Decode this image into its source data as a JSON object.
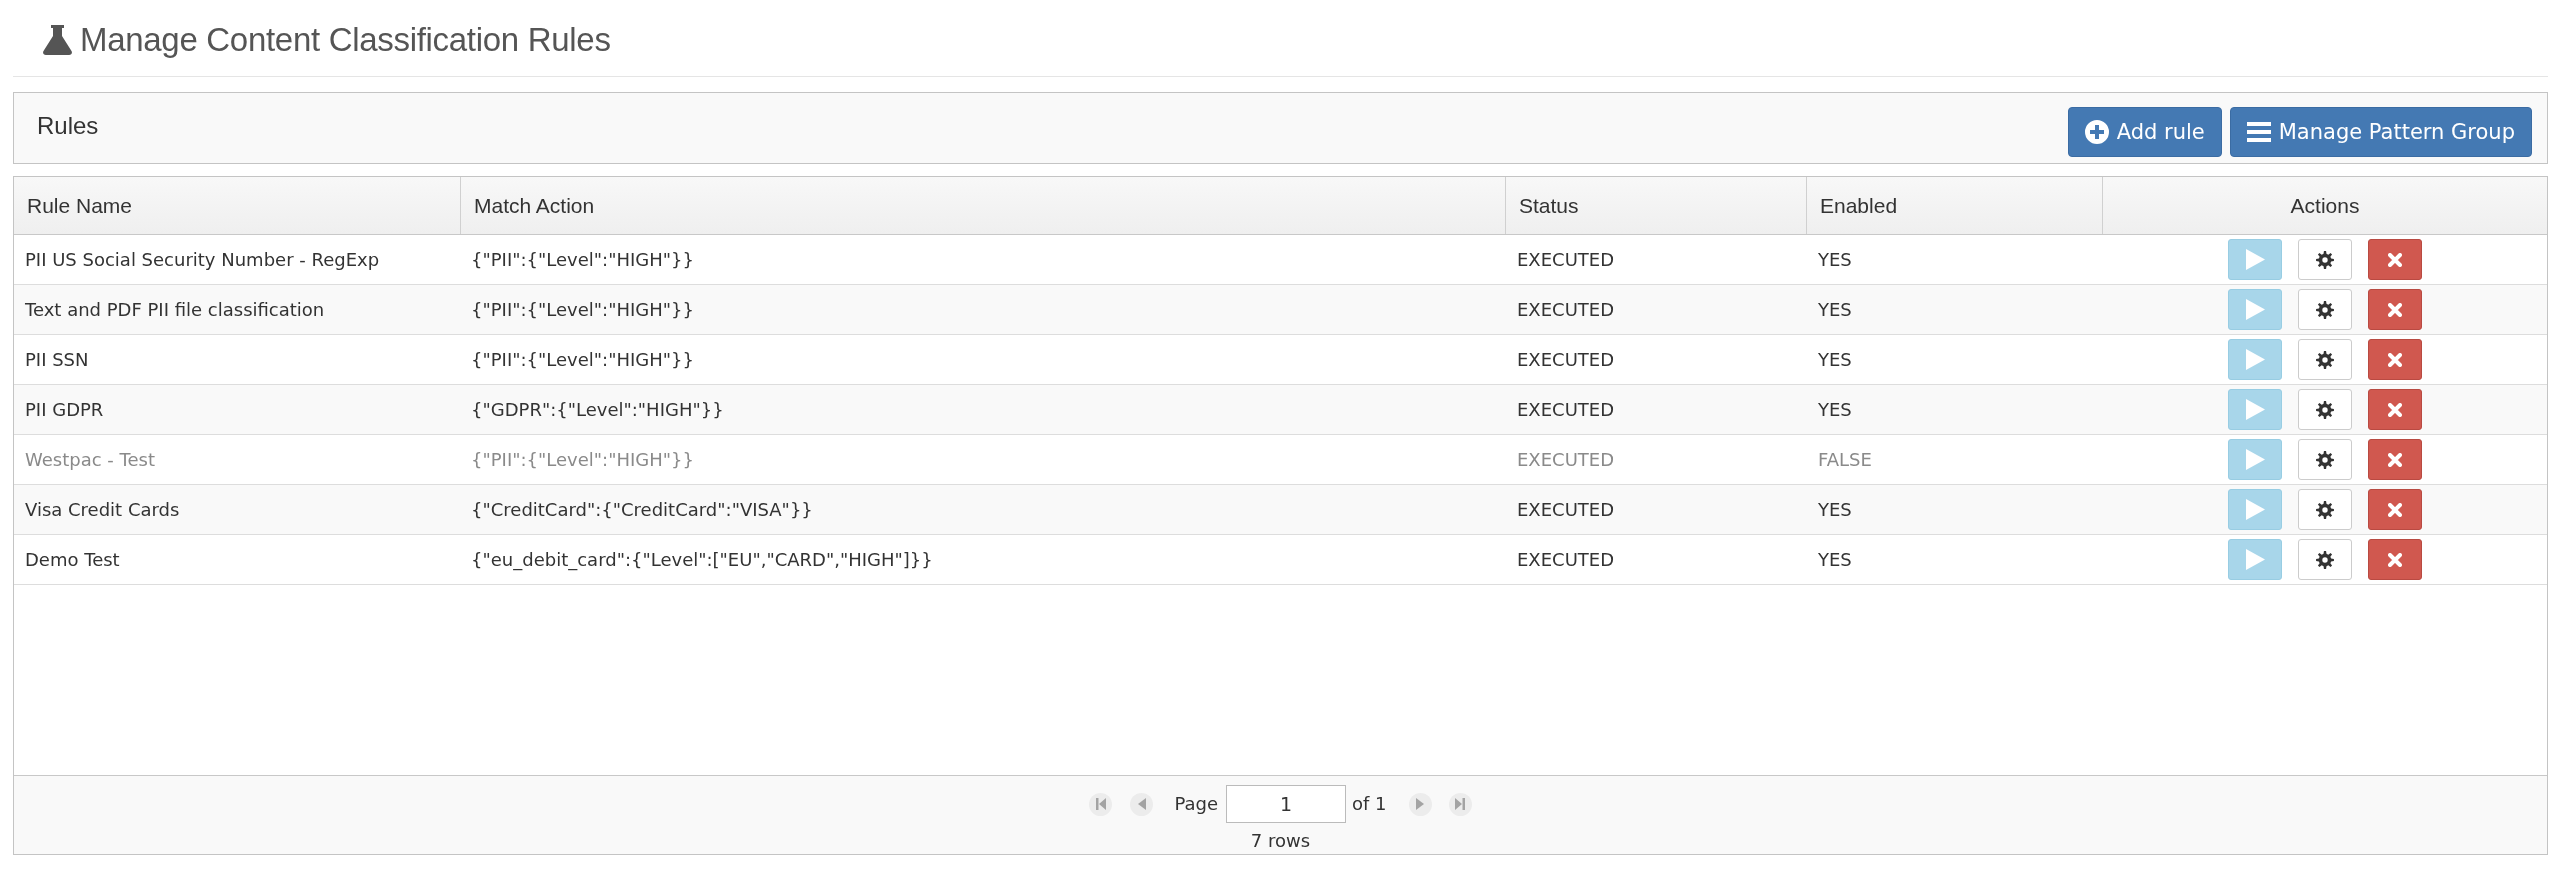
{
  "page": {
    "title": "Manage Content Classification Rules"
  },
  "panel": {
    "title": "Rules",
    "buttons": [
      {
        "label": "Add rule",
        "kind": "add"
      },
      {
        "label": "Manage Pattern Group",
        "kind": "list"
      }
    ]
  },
  "table": {
    "columns": [
      "Rule Name",
      "Match Action",
      "Status",
      "Enabled",
      "Actions"
    ],
    "rows": [
      {
        "rule_name": "PII US Social Security Number - RegExp",
        "match_action": "{\"PII\":{\"Level\":\"HIGH\"}}",
        "status": "EXECUTED",
        "enabled": "YES",
        "disabled": false
      },
      {
        "rule_name": "Text and PDF PII file classification",
        "match_action": "{\"PII\":{\"Level\":\"HIGH\"}}",
        "status": "EXECUTED",
        "enabled": "YES",
        "disabled": false
      },
      {
        "rule_name": "PII SSN",
        "match_action": "{\"PII\":{\"Level\":\"HIGH\"}}",
        "status": "EXECUTED",
        "enabled": "YES",
        "disabled": false
      },
      {
        "rule_name": "PII GDPR",
        "match_action": "{\"GDPR\":{\"Level\":\"HIGH\"}}",
        "status": "EXECUTED",
        "enabled": "YES",
        "disabled": false
      },
      {
        "rule_name": "Westpac - Test",
        "match_action": "{\"PII\":{\"Level\":\"HIGH\"}}",
        "status": "EXECUTED",
        "enabled": "FALSE",
        "disabled": true
      },
      {
        "rule_name": "Visa Credit Cards",
        "match_action": "{\"CreditCard\":{\"CreditCard\":\"VISA\"}}",
        "status": "EXECUTED",
        "enabled": "YES",
        "disabled": false
      },
      {
        "rule_name": "Demo Test",
        "match_action": "{\"eu_debit_card\":{\"Level\":[\"EU\",\"CARD\",\"HIGH\"]}}",
        "status": "EXECUTED",
        "enabled": "YES",
        "disabled": false
      }
    ]
  },
  "pager": {
    "page_label": "Page",
    "page": "1",
    "of_label": "of 1",
    "rows_label": "7 rows"
  }
}
